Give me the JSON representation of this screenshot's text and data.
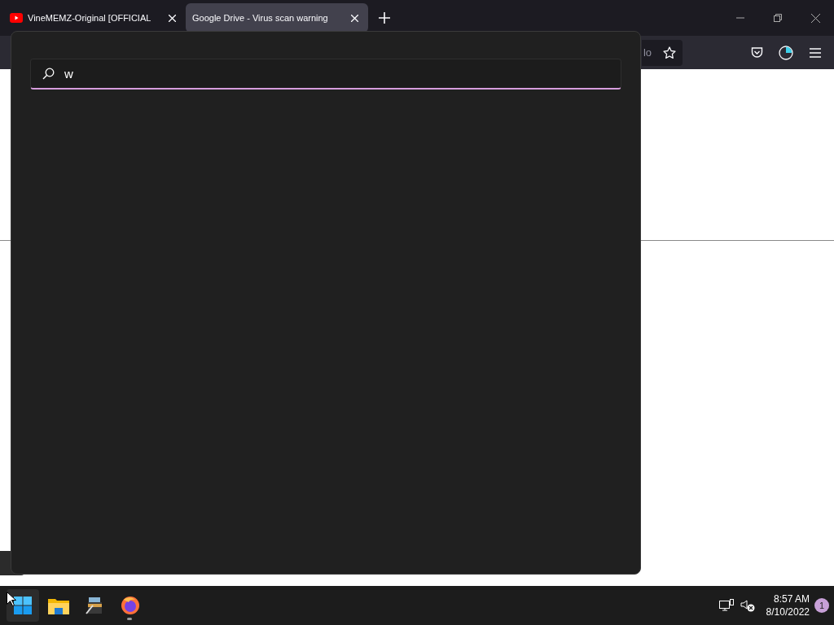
{
  "tabs": [
    {
      "title": "VineMEMZ-Original [OFFICIAL",
      "selected": false,
      "kind": "video"
    },
    {
      "title": "Google Drive - Virus scan warning",
      "selected": true,
      "kind": "page"
    }
  ],
  "toolbar": {
    "address_fragment": "lo"
  },
  "search": {
    "value": "w"
  },
  "taskbar": {
    "apps": [
      {
        "kind": "start",
        "running": false
      },
      {
        "kind": "folder",
        "running": false
      },
      {
        "kind": "archive",
        "running": false
      },
      {
        "kind": "browser",
        "running": true
      }
    ],
    "time": "8:57 AM",
    "date": "8/10/2022",
    "notifications": "1"
  }
}
